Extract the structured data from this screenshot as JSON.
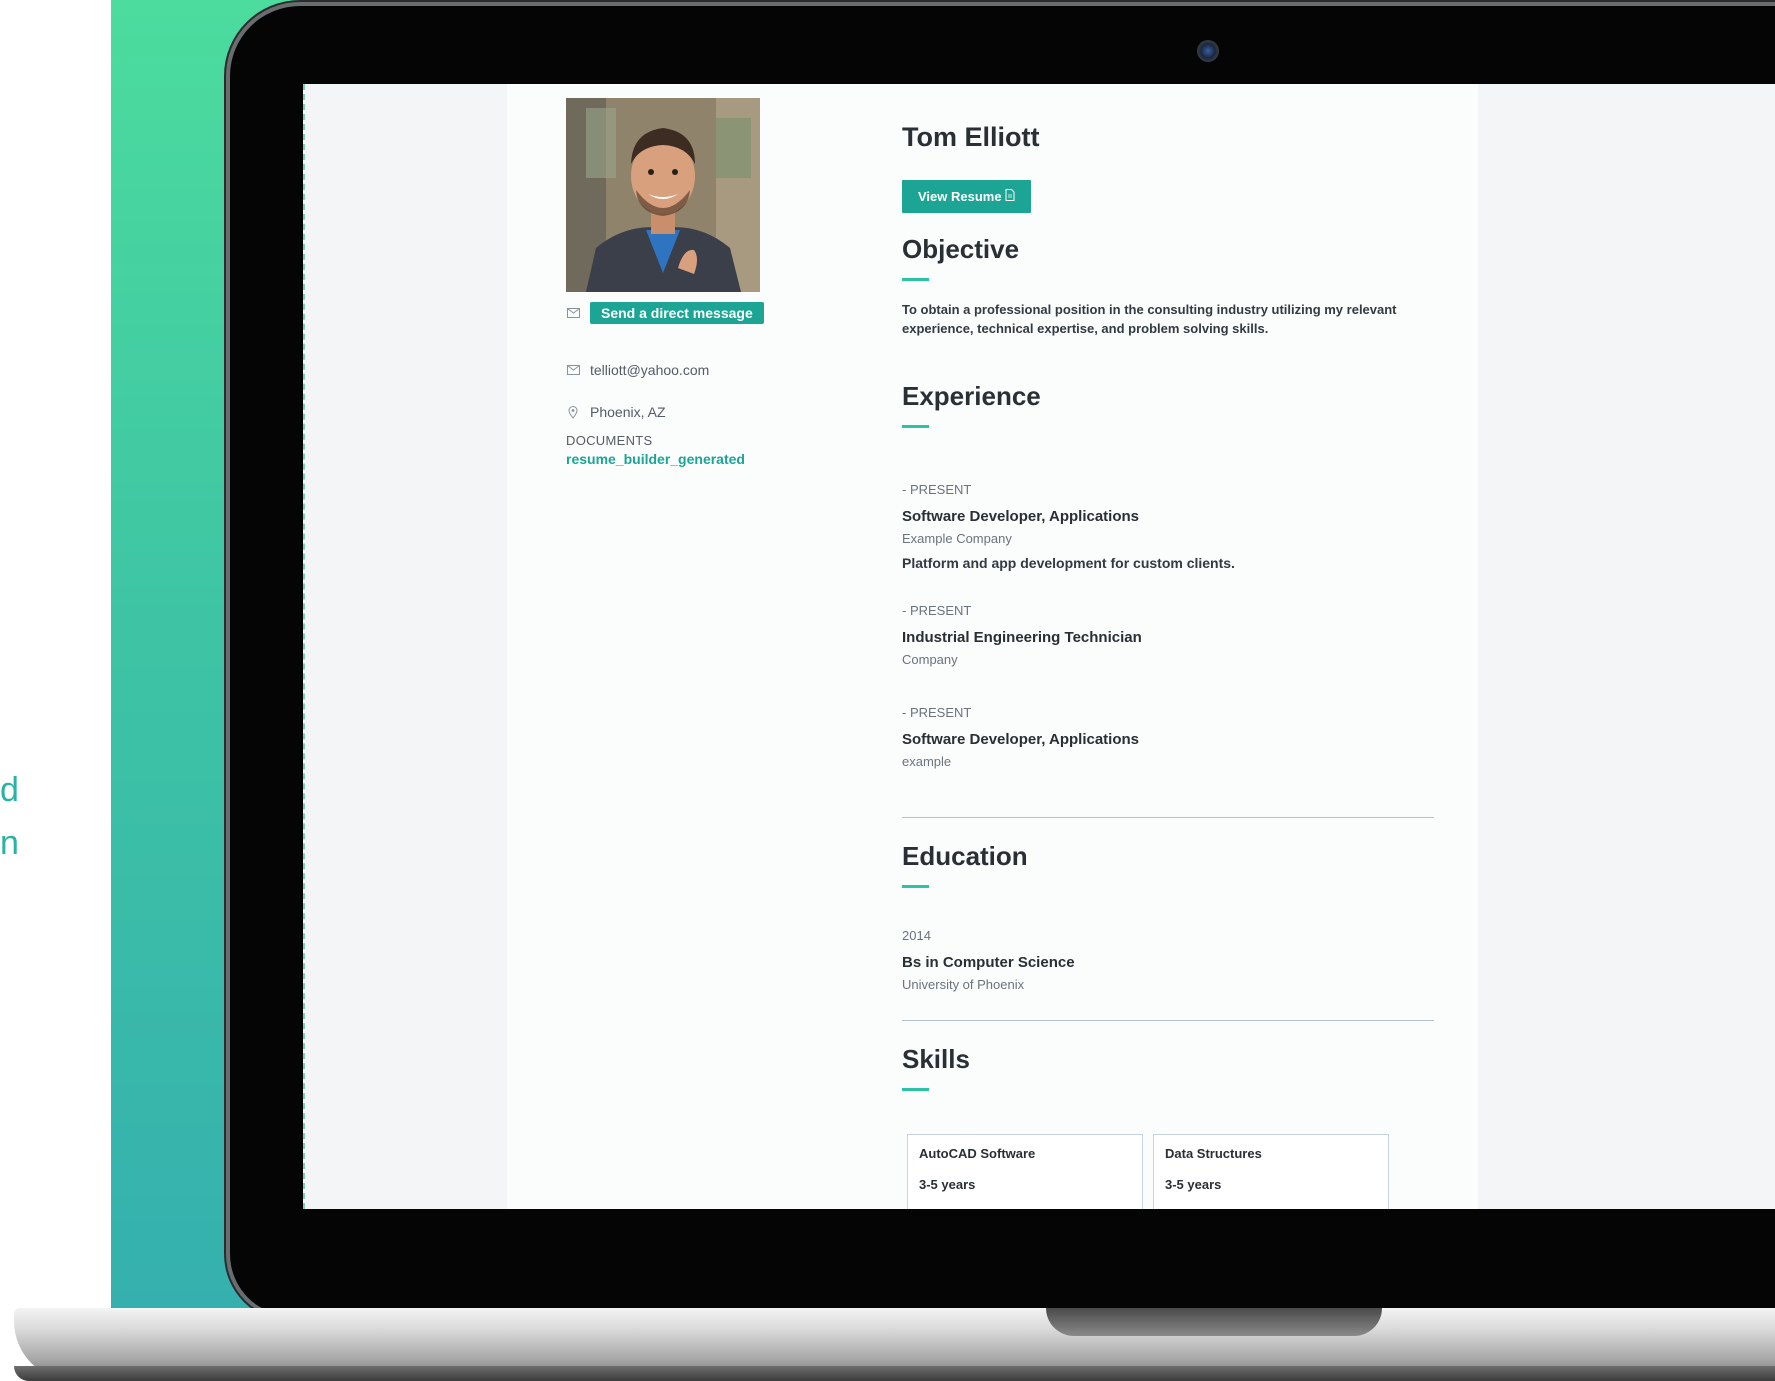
{
  "side_text": {
    "fragment_1": "d",
    "fragment_2": "n"
  },
  "profile": {
    "name": "Tom Elliott",
    "view_resume_label": "View Resume",
    "send_message_label": "Send a direct message",
    "email": "telliott@yahoo.com",
    "location": "Phoenix, AZ",
    "documents_label": "DOCUMENTS",
    "document_link": "resume_builder_generated"
  },
  "objective": {
    "title": "Objective",
    "text": "To obtain a professional position in the consulting industry utilizing my relevant experience, technical expertise, and problem solving skills."
  },
  "experience": {
    "title": "Experience",
    "jobs": [
      {
        "period": "- PRESENT",
        "title": "Software Developer, Applications",
        "company": "Example Company",
        "description": "Platform and app development for custom clients."
      },
      {
        "period": "- PRESENT",
        "title": "Industrial Engineering Technician",
        "company": "Company",
        "description": ""
      },
      {
        "period": "- PRESENT",
        "title": "Software Developer, Applications",
        "company": "example",
        "description": ""
      }
    ]
  },
  "education": {
    "title": "Education",
    "year": "2014",
    "degree": "Bs in Computer Science",
    "school": "University of Phoenix"
  },
  "skills": {
    "title": "Skills",
    "items": [
      {
        "name": "AutoCAD Software",
        "years": "3-5 years"
      },
      {
        "name": "Data Structures",
        "years": "3-5 years"
      }
    ]
  },
  "colors": {
    "accent": "#1ca594",
    "underline": "#2cc3a3",
    "gradient_top": "#4cdc9e",
    "gradient_bottom": "#34aeb0"
  },
  "icons": {
    "message": "envelope-icon",
    "email": "envelope-icon",
    "location": "map-pin-icon",
    "resume": "document-icon"
  }
}
